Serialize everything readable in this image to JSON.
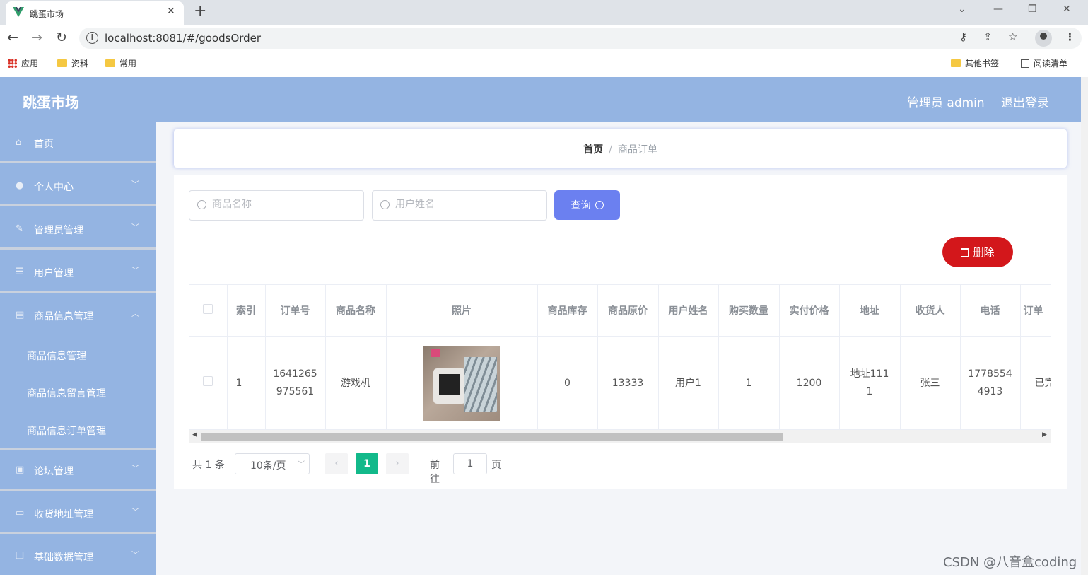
{
  "browser": {
    "tab_title": "跳蛋市场",
    "url": "localhost:8081/#/goodsOrder",
    "bookmarks": [
      "应用",
      "资料",
      "常用"
    ],
    "bookmarks_right": [
      "其他书签",
      "阅读清单"
    ]
  },
  "header": {
    "logo": "跳蛋市场",
    "user": "管理员 admin",
    "logout": "退出登录"
  },
  "sidebar": {
    "items": [
      {
        "label": "首页",
        "icon": "home-icon"
      },
      {
        "label": "个人中心",
        "icon": "user-icon"
      },
      {
        "label": "管理员管理",
        "icon": "admin-icon"
      },
      {
        "label": "用户管理",
        "icon": "list-icon"
      },
      {
        "label": "商品信息管理",
        "icon": "document-icon",
        "expanded": true
      }
    ],
    "sub_items": [
      "商品信息管理",
      "商品信息留言管理",
      "商品信息订单管理"
    ],
    "items_after": [
      {
        "label": "论坛管理",
        "icon": "forum-icon"
      },
      {
        "label": "收货地址管理",
        "icon": "address-icon"
      },
      {
        "label": "基础数据管理",
        "icon": "data-icon"
      }
    ]
  },
  "breadcrumb": {
    "home": "首页",
    "separator": "/",
    "current": "商品订单"
  },
  "search": {
    "goods_placeholder": "商品名称",
    "user_placeholder": "用户姓名",
    "query_label": "查询"
  },
  "delete_label": "删除",
  "table": {
    "columns": [
      "索引",
      "订单号",
      "商品名称",
      "照片",
      "商品库存",
      "商品原价",
      "用户姓名",
      "购买数量",
      "实付价格",
      "地址",
      "收货人",
      "电话",
      "订单"
    ],
    "rows": [
      {
        "index": "1",
        "order_no": "1641265975561",
        "goods_name": "游戏机",
        "stock": "0",
        "original_price": "13333",
        "user_name": "用户1",
        "quantity": "1",
        "paid_price": "1200",
        "address": "地址1111",
        "receiver": "张三",
        "phone": "17785544913",
        "status": "已完"
      }
    ]
  },
  "pagination": {
    "total": "共 1 条",
    "page_size": "10条/页",
    "current_page": "1",
    "goto": "前往",
    "goto_value": "1",
    "page_suffix": "页"
  },
  "watermark": "CSDN @八音盒coding"
}
